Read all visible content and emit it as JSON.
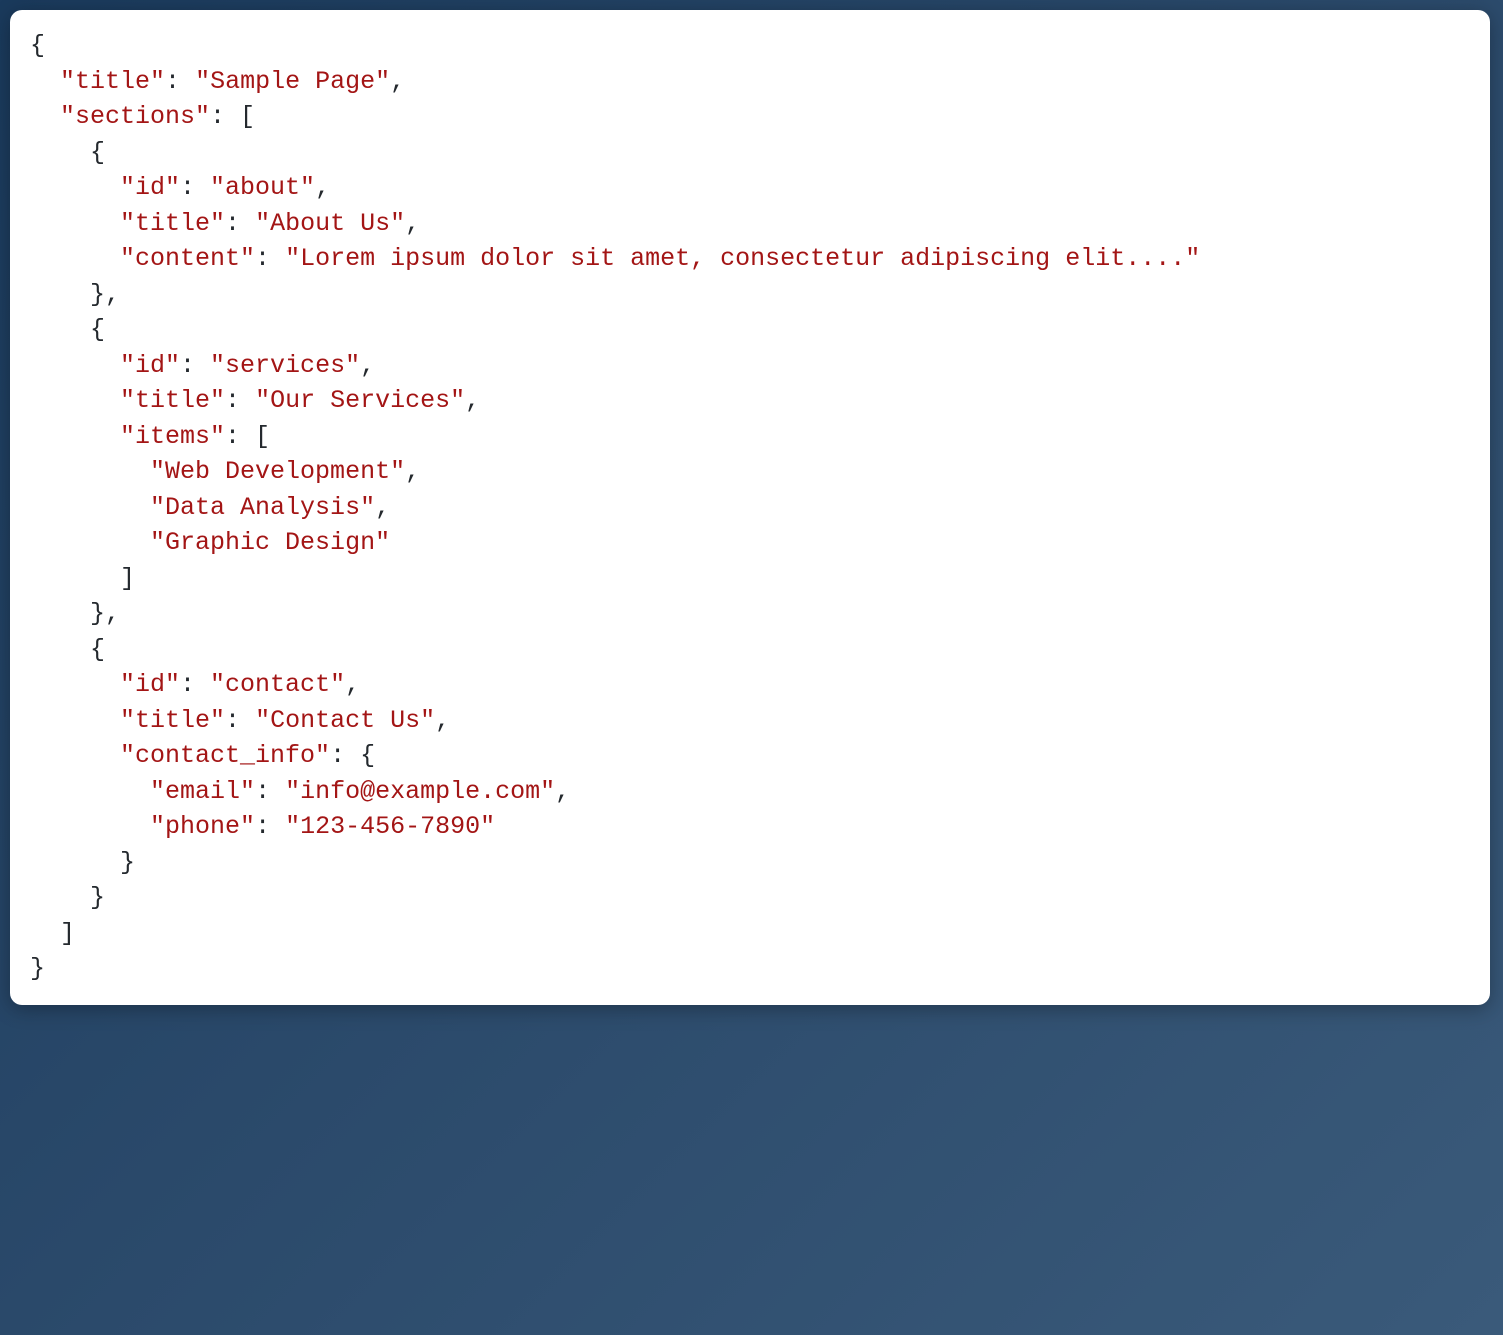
{
  "code": {
    "tokens": [
      {
        "t": "{",
        "c": "p",
        "nl": true
      },
      {
        "t": "  ",
        "c": "p"
      },
      {
        "t": "\"title\"",
        "c": "s"
      },
      {
        "t": ": ",
        "c": "p"
      },
      {
        "t": "\"Sample Page\"",
        "c": "s"
      },
      {
        "t": ",",
        "c": "p",
        "nl": true
      },
      {
        "t": "  ",
        "c": "p"
      },
      {
        "t": "\"sections\"",
        "c": "s"
      },
      {
        "t": ": [",
        "c": "p",
        "nl": true
      },
      {
        "t": "    {",
        "c": "p",
        "nl": true
      },
      {
        "t": "      ",
        "c": "p"
      },
      {
        "t": "\"id\"",
        "c": "s"
      },
      {
        "t": ": ",
        "c": "p"
      },
      {
        "t": "\"about\"",
        "c": "s"
      },
      {
        "t": ",",
        "c": "p",
        "nl": true
      },
      {
        "t": "      ",
        "c": "p"
      },
      {
        "t": "\"title\"",
        "c": "s"
      },
      {
        "t": ": ",
        "c": "p"
      },
      {
        "t": "\"About Us\"",
        "c": "s"
      },
      {
        "t": ",",
        "c": "p",
        "nl": true
      },
      {
        "t": "      ",
        "c": "p"
      },
      {
        "t": "\"content\"",
        "c": "s"
      },
      {
        "t": ": ",
        "c": "p"
      },
      {
        "t": "\"Lorem ipsum dolor sit amet, consectetur adipiscing elit....\"",
        "c": "s",
        "nl": true
      },
      {
        "t": "    },",
        "c": "p",
        "nl": true
      },
      {
        "t": "    {",
        "c": "p",
        "nl": true
      },
      {
        "t": "      ",
        "c": "p"
      },
      {
        "t": "\"id\"",
        "c": "s"
      },
      {
        "t": ": ",
        "c": "p"
      },
      {
        "t": "\"services\"",
        "c": "s"
      },
      {
        "t": ",",
        "c": "p",
        "nl": true
      },
      {
        "t": "      ",
        "c": "p"
      },
      {
        "t": "\"title\"",
        "c": "s"
      },
      {
        "t": ": ",
        "c": "p"
      },
      {
        "t": "\"Our Services\"",
        "c": "s"
      },
      {
        "t": ",",
        "c": "p",
        "nl": true
      },
      {
        "t": "      ",
        "c": "p"
      },
      {
        "t": "\"items\"",
        "c": "s"
      },
      {
        "t": ": [",
        "c": "p",
        "nl": true
      },
      {
        "t": "        ",
        "c": "p"
      },
      {
        "t": "\"Web Development\"",
        "c": "s"
      },
      {
        "t": ",",
        "c": "p",
        "nl": true
      },
      {
        "t": "        ",
        "c": "p"
      },
      {
        "t": "\"Data Analysis\"",
        "c": "s"
      },
      {
        "t": ",",
        "c": "p",
        "nl": true
      },
      {
        "t": "        ",
        "c": "p"
      },
      {
        "t": "\"Graphic Design\"",
        "c": "s",
        "nl": true
      },
      {
        "t": "      ]",
        "c": "p",
        "nl": true
      },
      {
        "t": "    },",
        "c": "p",
        "nl": true
      },
      {
        "t": "    {",
        "c": "p",
        "nl": true
      },
      {
        "t": "      ",
        "c": "p"
      },
      {
        "t": "\"id\"",
        "c": "s"
      },
      {
        "t": ": ",
        "c": "p"
      },
      {
        "t": "\"contact\"",
        "c": "s"
      },
      {
        "t": ",",
        "c": "p",
        "nl": true
      },
      {
        "t": "      ",
        "c": "p"
      },
      {
        "t": "\"title\"",
        "c": "s"
      },
      {
        "t": ": ",
        "c": "p"
      },
      {
        "t": "\"Contact Us\"",
        "c": "s"
      },
      {
        "t": ",",
        "c": "p",
        "nl": true
      },
      {
        "t": "      ",
        "c": "p"
      },
      {
        "t": "\"contact_info\"",
        "c": "s"
      },
      {
        "t": ": {",
        "c": "p",
        "nl": true
      },
      {
        "t": "        ",
        "c": "p"
      },
      {
        "t": "\"email\"",
        "c": "s"
      },
      {
        "t": ": ",
        "c": "p"
      },
      {
        "t": "\"info@example.com\"",
        "c": "s"
      },
      {
        "t": ",",
        "c": "p",
        "nl": true
      },
      {
        "t": "        ",
        "c": "p"
      },
      {
        "t": "\"phone\"",
        "c": "s"
      },
      {
        "t": ": ",
        "c": "p"
      },
      {
        "t": "\"123-456-7890\"",
        "c": "s",
        "nl": true
      },
      {
        "t": "      }",
        "c": "p",
        "nl": true
      },
      {
        "t": "    }",
        "c": "p",
        "nl": true
      },
      {
        "t": "  ]",
        "c": "p",
        "nl": true
      },
      {
        "t": "}",
        "c": "p"
      }
    ]
  }
}
